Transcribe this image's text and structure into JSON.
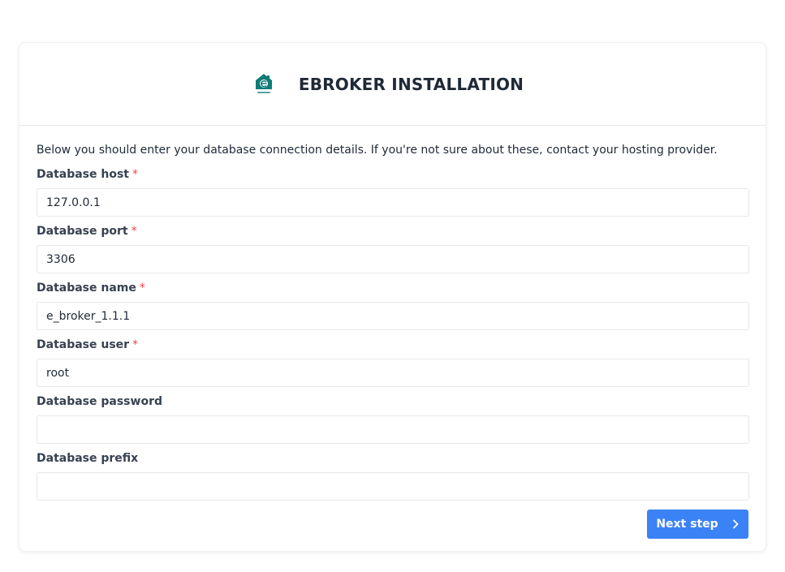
{
  "header": {
    "title": "EBROKER INSTALLATION",
    "logo_icon": "ebroker-house-logo",
    "logo_color": "#0e7c75"
  },
  "intro_text": "Below you should enter your database connection details. If you're not sure about these, contact your hosting provider.",
  "fields": [
    {
      "label": "Database host",
      "required": true,
      "value": "127.0.0.1"
    },
    {
      "label": "Database port",
      "required": true,
      "value": "3306"
    },
    {
      "label": "Database name",
      "required": true,
      "value": "e_broker_1.1.1"
    },
    {
      "label": "Database user",
      "required": true,
      "value": "root"
    },
    {
      "label": "Database password",
      "required": false,
      "value": ""
    },
    {
      "label": "Database prefix",
      "required": false,
      "value": ""
    }
  ],
  "required_marker": "*",
  "next_button": {
    "label": "Next step",
    "icon": "chevron-right-icon",
    "color": "#3b82f6"
  }
}
